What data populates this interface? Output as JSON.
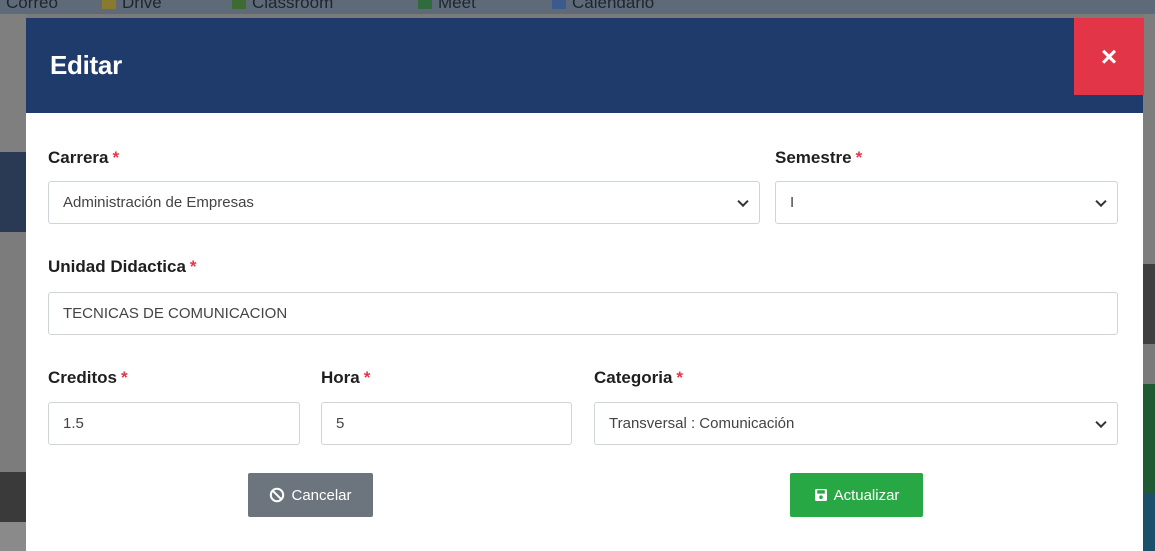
{
  "background": {
    "bookmarks": [
      "Correo",
      "Drive",
      "Classroom",
      "Meet",
      "Calendario"
    ]
  },
  "modal": {
    "title": "Editar",
    "close_label": "×",
    "fields": {
      "carrera": {
        "label": "Carrera",
        "value": "Administración de Empresas"
      },
      "semestre": {
        "label": "Semestre",
        "value": "I"
      },
      "unidad": {
        "label": "Unidad Didactica",
        "value": "TECNICAS DE COMUNICACION"
      },
      "creditos": {
        "label": "Creditos",
        "value": "1.5"
      },
      "hora": {
        "label": "Hora",
        "value": "5"
      },
      "categoria": {
        "label": "Categoria",
        "value": "Transversal : Comunicación"
      }
    },
    "required_mark": "*",
    "buttons": {
      "cancel": "Cancelar",
      "save": "Actualizar"
    }
  },
  "colors": {
    "header": "#1f3b6b",
    "close": "#e23547",
    "required": "#e23547",
    "cancel": "#6c757d",
    "save": "#28a745"
  }
}
